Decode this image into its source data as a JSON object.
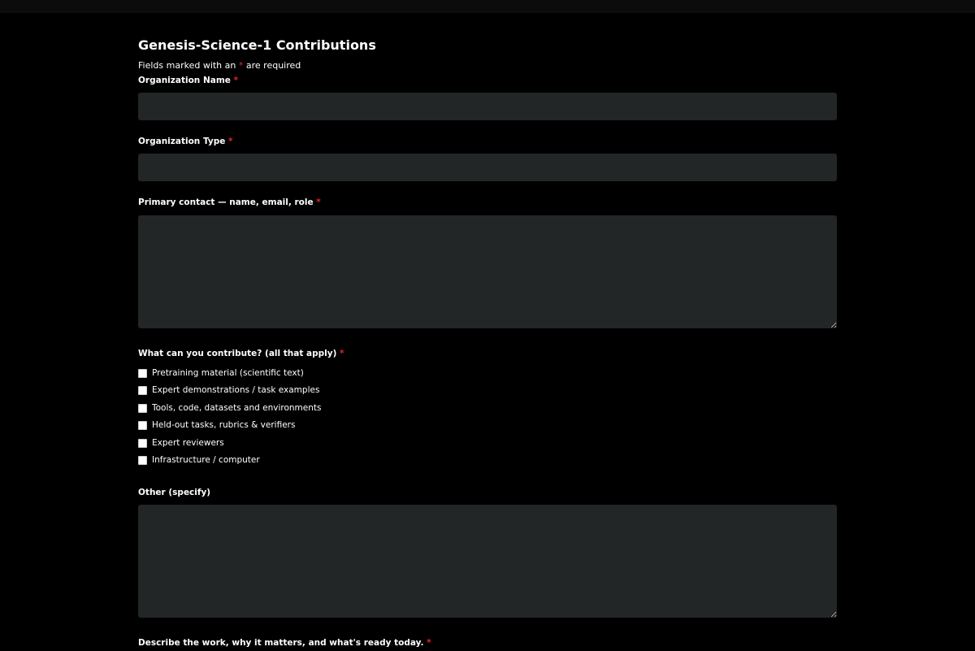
{
  "form": {
    "title": "Genesis-Science-1 Contributions",
    "required_note_prefix": "Fields marked with an ",
    "required_star": "*",
    "required_note_suffix": " are required",
    "org_name_label": "Organization Name",
    "org_type_label": "Organization Type",
    "contact_label": "Primary contact — name, email, role",
    "contribute_label": "What can you contribute? (all that apply)",
    "contribute_options": [
      "Pretraining material (scientific text)",
      "Expert demonstrations / task examples",
      "Tools, code, datasets and environments",
      "Held-out tasks, rubrics & verifiers",
      "Expert reviewers",
      "Infrastructure / computer"
    ],
    "other_label": "Other (specify)",
    "describe_label": "Describe the work, why it matters, and what's ready today."
  },
  "colors": {
    "background": "#000000",
    "field": "#232627",
    "required_star": "#e8252b"
  }
}
